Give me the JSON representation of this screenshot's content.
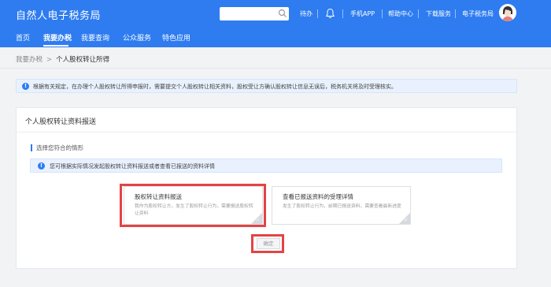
{
  "header": {
    "brand": "自然人电子税务局",
    "search_placeholder": "",
    "nav": {
      "todo": "待办",
      "mobile_app": "手机APP",
      "help": "帮助中心",
      "download": "下载服务",
      "etax": "电子税务局"
    }
  },
  "main_nav": [
    "首页",
    "我要办税",
    "我要查询",
    "公众服务",
    "特色应用"
  ],
  "breadcrumb": {
    "parent": "我要办税",
    "arrow": ">",
    "current": "个人股权转让所得"
  },
  "notice": {
    "text": "根据有关规定，在办理个人股权转让所得申报时，需要提交个人股权转让相关资料，股权受让方确认股权转让信息无误后，税务机关将及时受理核实。"
  },
  "panel": {
    "title": "个人股权转让资料报送",
    "section_label": "选择您符合的情形",
    "hint": "您可根据实际情况发起股权转让资料报送或者查看已报送的资料详情",
    "cards": [
      {
        "title": "股权转让资料报送",
        "desc": "我作为股权转让方，发生了股权转让行为，需要报送股权转让资料"
      },
      {
        "title": "查看已报送资料的受理详情",
        "desc": "发生了股权转让行为，前期已报送资料，需要查看最新进度"
      }
    ],
    "confirm_label": "确定"
  },
  "colors": {
    "header_bg": "#2e7cf0",
    "highlight": "#e24444",
    "notice_bg": "#e8f1fd"
  }
}
